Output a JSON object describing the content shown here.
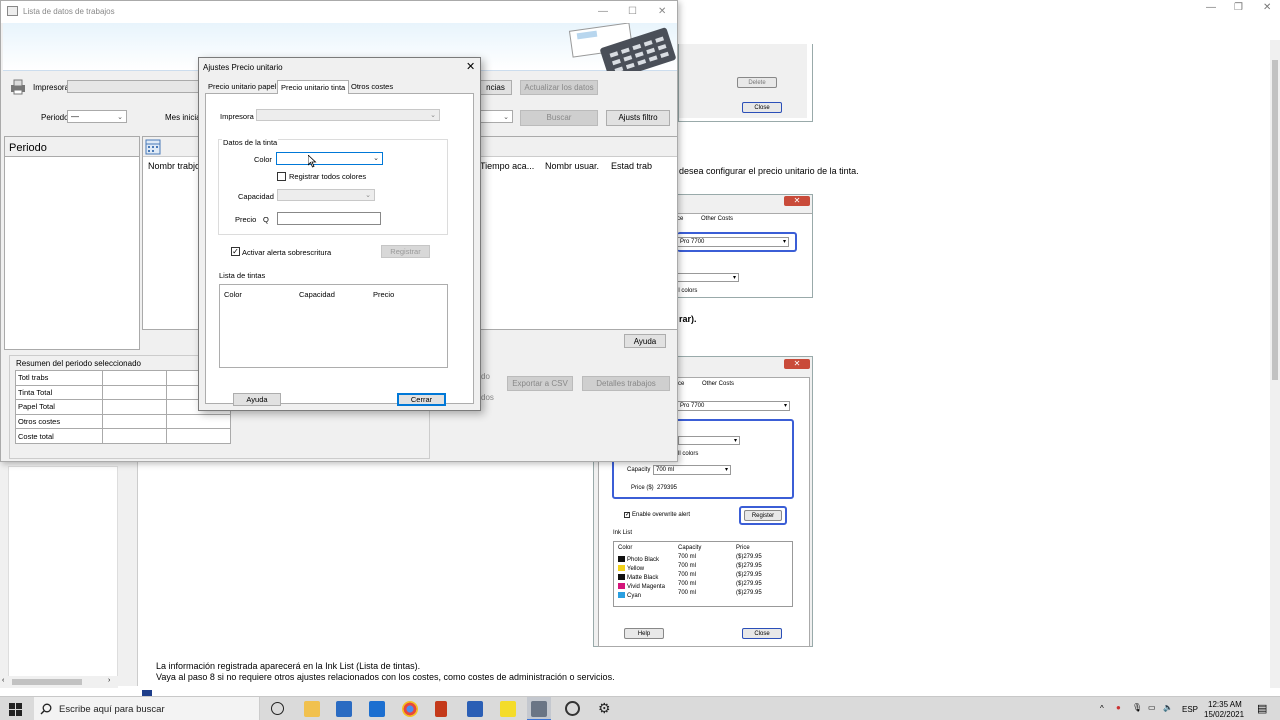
{
  "help_window": {
    "paragraph_top": "desea configurar el precio unitario de la tinta.",
    "paragraph_mid": "rar).",
    "footer_line1": "La información registrada aparecerá en la Ink List (Lista de tintas).",
    "footer_line2": "Vaya al paso 8 si no requiere otros ajustes relacionados con los costes, como costes de administración o servicios."
  },
  "mock_top": {
    "delete": "Delete",
    "close": "Close"
  },
  "mock_mid": {
    "close_x": "✕",
    "tab_suffix": "ce",
    "tab_other": "Other Costs",
    "printer": "Pro 7700",
    "all_colors": "ll colors"
  },
  "mock_bottom": {
    "close_x": "✕",
    "tab_suffix": "ce",
    "tab_other": "Other Costs",
    "printer": "Pro 7700",
    "all_colors": "ll colors",
    "capacity_label": "Capacity",
    "capacity_value": "700 ml",
    "price_label": "Price ($)",
    "price_value": "279395",
    "overwrite": "Enable overwrite alert",
    "register": "Register",
    "ink_list": "Ink List",
    "col_color": "Color",
    "col_capacity": "Capacity",
    "col_price": "Price",
    "rows": [
      {
        "color": "Photo Black",
        "capacity": "700 ml",
        "price": "($)279.95",
        "swatch": "#111111"
      },
      {
        "color": "Yellow",
        "capacity": "700 ml",
        "price": "($)279.95",
        "swatch": "#f2d21a"
      },
      {
        "color": "Matte Black",
        "capacity": "700 ml",
        "price": "($)279.95",
        "swatch": "#111111"
      },
      {
        "color": "Vivid Magenta",
        "capacity": "700 ml",
        "price": "($)279.95",
        "swatch": "#d4147a"
      },
      {
        "color": "Cyan",
        "capacity": "700 ml",
        "price": "($)279.95",
        "swatch": "#2a9fe0"
      }
    ],
    "help": "Help",
    "close": "Close"
  },
  "app": {
    "title": "Lista de datos de trabajos",
    "printer_label": "Impresora",
    "period_label": "Periodo",
    "period_value": "—",
    "month_label": "Mes inicial",
    "btn_ncias": "ncias",
    "btn_update": "Actualizar los datos",
    "btn_search": "Buscar",
    "btn_filter": "Ajusts filtro",
    "period_header": "Periodo",
    "col_job": "Nombr trabjo",
    "col_time": "Tiempo aca...",
    "col_user": "Nombr usuar.",
    "col_state": "Estad trab",
    "btn_help": "Ayuda",
    "summary_title": "Resumen del periodo seleccionado",
    "summary_rows": [
      "Totl trabs",
      "Tinta Total",
      "Papel Total",
      "Otros costes",
      "Coste total"
    ],
    "side_do": "do",
    "side_dos": "dos",
    "btn_export": "Exportar a CSV",
    "btn_details": "Detalles trabajos"
  },
  "dialog": {
    "title": "Ajustes Precio unitario",
    "tabs": [
      "Precio unitario papel",
      "Precio unitario tinta",
      "Otros costes"
    ],
    "printer_label": "Impresora",
    "ink_group": "Datos de la tinta",
    "color_label": "Color",
    "register_all": "Registrar todos colores",
    "capacity_label": "Capacidad",
    "price_label": "Precio",
    "currency": "Q",
    "overwrite_alert": "Activar alerta sobrescritura",
    "register_btn": "Registrar",
    "ink_list_label": "Lista de tintas",
    "list_cols": [
      "Color",
      "Capacidad",
      "Precio"
    ],
    "help_btn": "Ayuda",
    "close_btn": "Cerrar"
  },
  "taskbar": {
    "search_placeholder": "Escribe aquí para buscar",
    "lang": "ESP",
    "time": "12:35 AM",
    "date": "15/02/2021"
  }
}
